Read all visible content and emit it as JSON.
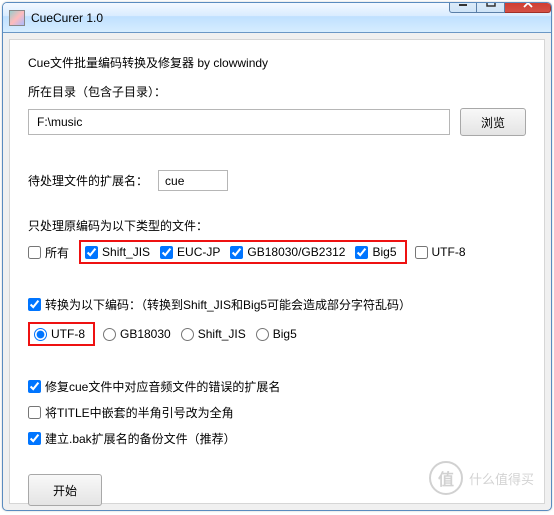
{
  "window": {
    "title": "CueCurer 1.0"
  },
  "heading": "Cue文件批量编码转换及修复器 by clowwindy",
  "dir": {
    "label": "所在目录（包含子目录）：",
    "value": "F:\\music",
    "browse": "浏览"
  },
  "ext": {
    "label": "待处理文件的扩展名：",
    "value": "cue"
  },
  "source_enc": {
    "label": "只处理原编码为以下类型的文件：",
    "all": "所有",
    "shift_jis": "Shift_JIS",
    "euc_jp": "EUC-JP",
    "gb": "GB18030/GB2312",
    "big5": "Big5",
    "utf8": "UTF-8"
  },
  "target_enc": {
    "label": "转换为以下编码：（转换到Shift_JIS和Big5可能会造成部分字符乱码）",
    "utf8": "UTF-8",
    "gb": "GB18030",
    "shift_jis": "Shift_JIS",
    "big5": "Big5"
  },
  "options": {
    "fix_audio_ext": "修复cue文件中对应音频文件的错误的扩展名",
    "title_quotes": "将TITLE中嵌套的半角引号改为全角",
    "backup": "建立.bak扩展名的备份文件（推荐）"
  },
  "start": "开始",
  "watermark": {
    "char": "值",
    "text": "什么值得买"
  }
}
